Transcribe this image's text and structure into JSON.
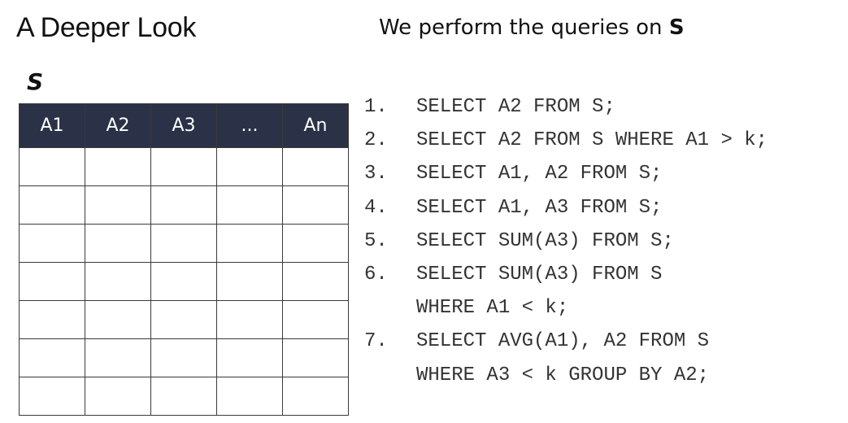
{
  "slide": {
    "title": "A Deeper Look",
    "subtitle_prefix": "We perform the queries on ",
    "subtitle_table": "S"
  },
  "table": {
    "name": "S",
    "columns": [
      "A1",
      "A2",
      "A3",
      "...",
      "An"
    ],
    "header_color": "#2b3247",
    "empty_row_count": 7
  },
  "queries": [
    {
      "number": "1.",
      "lines": [
        "SELECT A2 FROM S;"
      ]
    },
    {
      "number": "2.",
      "lines": [
        "SELECT A2 FROM S WHERE A1 > k;"
      ]
    },
    {
      "number": "3.",
      "lines": [
        "SELECT A1, A2 FROM S;"
      ]
    },
    {
      "number": "4.",
      "lines": [
        "SELECT A1, A3 FROM S;"
      ]
    },
    {
      "number": "5.",
      "lines": [
        "SELECT SUM(A3) FROM S;"
      ]
    },
    {
      "number": "6.",
      "lines": [
        "SELECT SUM(A3) FROM S",
        "WHERE A1 < k;"
      ]
    },
    {
      "number": "7.",
      "lines": [
        "SELECT AVG(A1), A2 FROM S",
        "WHERE A3 < k GROUP BY A2;"
      ]
    }
  ]
}
